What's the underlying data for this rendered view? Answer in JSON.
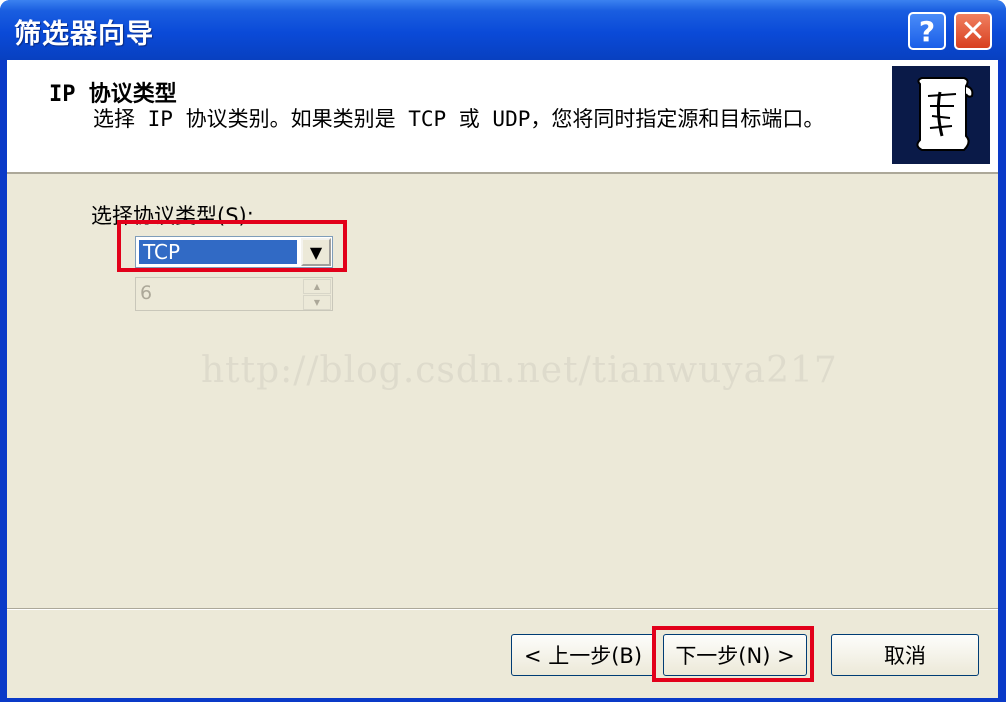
{
  "window": {
    "title": "筛选器向导"
  },
  "titlebar": {
    "help_label": "?",
    "close_label": "✕"
  },
  "header": {
    "title": "IP 协议类型",
    "description": "选择 IP 协议类别。如果类别是 TCP 或 UDP，您将同时指定源和目标端口。"
  },
  "protocol": {
    "label": "选择协议类型(S):",
    "selected": "TCP",
    "dropdown_arrow": "▼",
    "number": "6",
    "number_enabled": false
  },
  "watermark": "http://blog.csdn.net/tianwuya217",
  "buttons": {
    "back": "< 上一步(B)",
    "next": "下一步(N) >",
    "cancel": "取消"
  },
  "colors": {
    "titlebar": "#0a4ad8",
    "highlight": "#e2001a",
    "selection": "#316ac5",
    "dialog_bg": "#ece9d8"
  },
  "icons": [
    "help-icon",
    "close-icon",
    "scroll-icon",
    "dropdown-arrow-icon",
    "spin-up-icon",
    "spin-down-icon"
  ]
}
